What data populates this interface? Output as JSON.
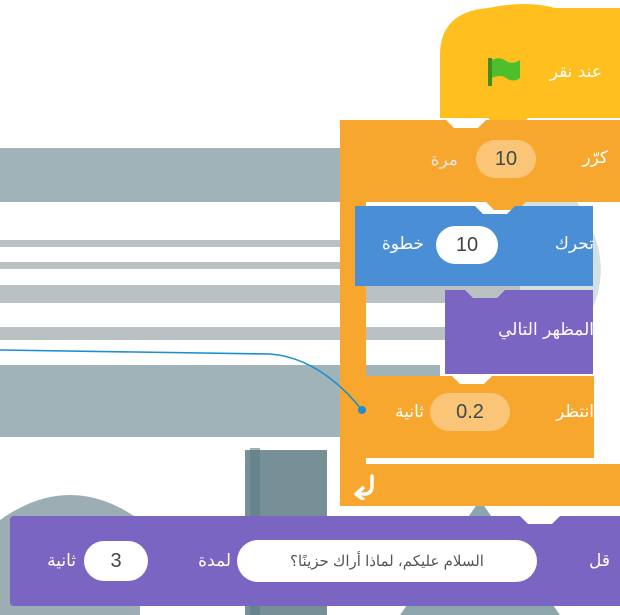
{
  "script": {
    "hat": {
      "label": "عند نقر"
    },
    "repeat": {
      "label": "كرّر",
      "value": "10",
      "suffix": "مرة"
    },
    "move": {
      "label": "تحرك",
      "value": "10",
      "suffix": "خطوة"
    },
    "costume": {
      "label": "المظهر التالي"
    },
    "wait": {
      "label": "انتظر",
      "value": "0.2",
      "suffix": "ثانية"
    },
    "say": {
      "label": "قل",
      "message": "السلام عليكم، لماذا أراك حزينًا؟",
      "for_label": "لمدة",
      "value": "3",
      "suffix": "ثانية"
    }
  },
  "colors": {
    "events": "#ffbf1f",
    "control": "#f7a72e",
    "motion": "#4a8fd6",
    "looks": "#7a66c2",
    "band": "#9fb3b8"
  },
  "icons": [
    "green-flag-icon",
    "loop-arrow-icon"
  ]
}
